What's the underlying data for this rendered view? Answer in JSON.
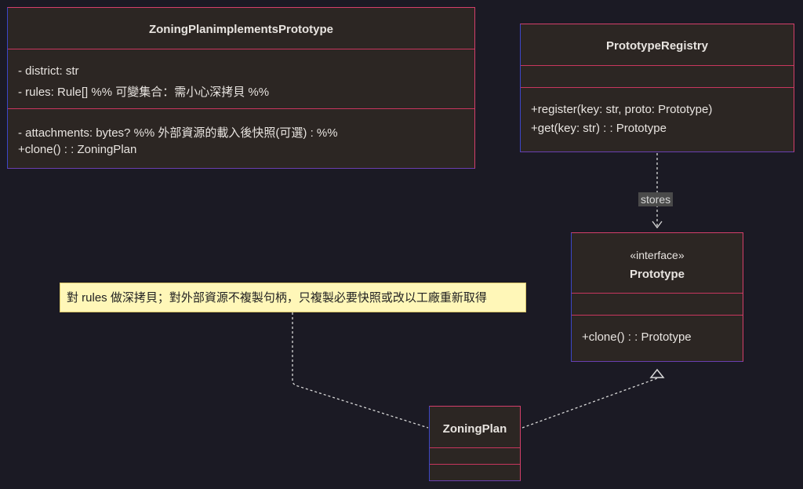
{
  "classes": {
    "zoning_impl": {
      "name": "ZoningPlanimplementsPrototype",
      "attributes": [
        "- district: str",
        "- rules: Rule[] %% 可變集合：需小心深拷貝 %%"
      ],
      "methods": [
        "- attachments: bytes? %% 外部資源的載入後快照(可選) : %%",
        "+clone() : : ZoningPlan"
      ]
    },
    "registry": {
      "name": "PrototypeRegistry",
      "methods": [
        "+register(key: str, proto: Prototype)",
        "+get(key: str) : : Prototype"
      ]
    },
    "prototype": {
      "stereotype": "«interface»",
      "name": "Prototype",
      "methods": [
        "+clone() : : Prototype"
      ]
    },
    "zoning_plan": {
      "name": "ZoningPlan"
    }
  },
  "relations": {
    "stores_label": "stores"
  },
  "note": {
    "text": "對 rules 做深拷貝；對外部資源不複製句柄，只複製必要快照或改以工廠重新取得"
  },
  "colors": {
    "background": "#1b1a24",
    "class_fill": "#2c2623",
    "border_red": "#d43f6a",
    "border_blue": "#3c46c8",
    "note_fill": "#fff7b8"
  }
}
